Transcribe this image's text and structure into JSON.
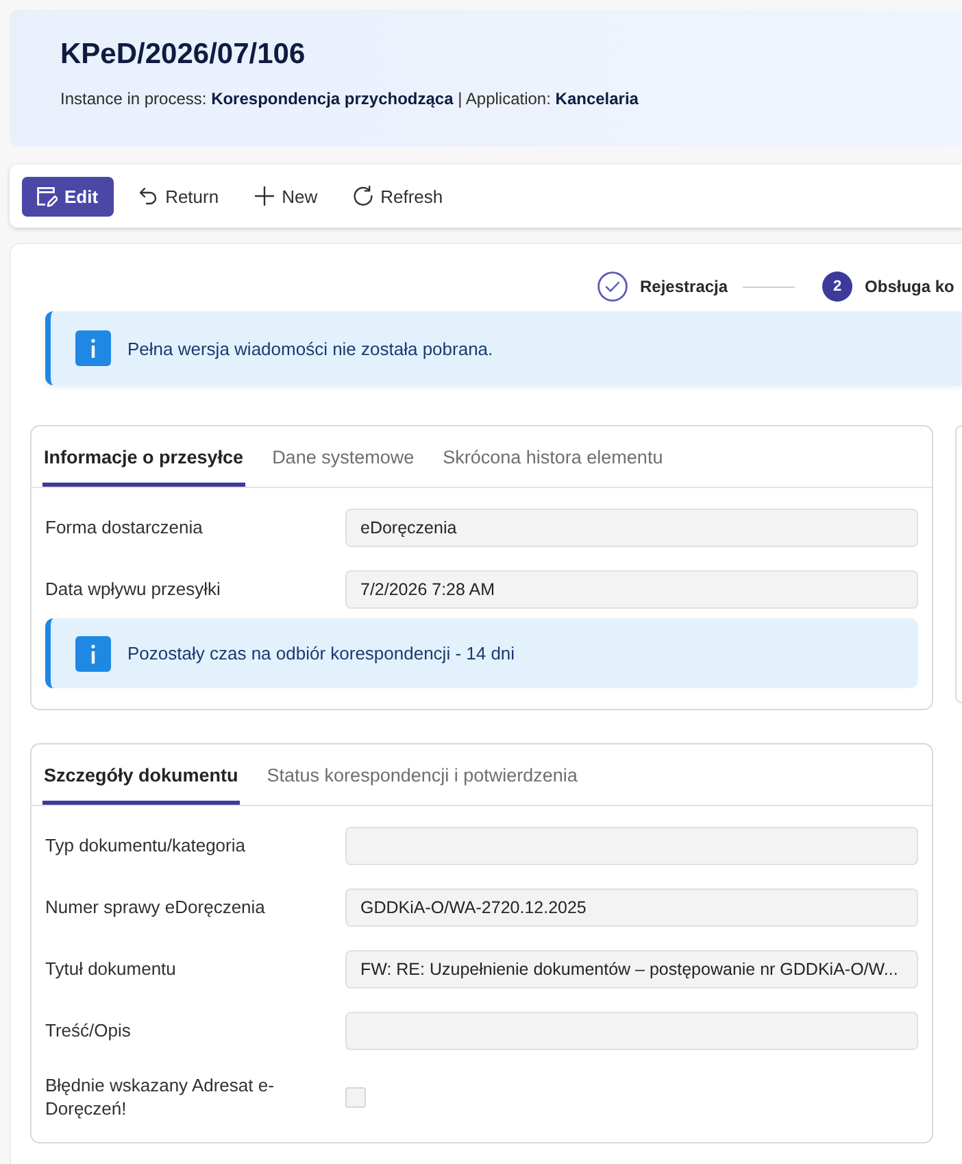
{
  "header": {
    "title": "KPeD/2026/07/106",
    "subtitle": "Instance in process: **Korespondencja przychodząca** | Application: **Kancelaria**"
  },
  "toolbar": {
    "buttons": [
      {
        "label": "Edit",
        "kind": "edit",
        "primary": true
      },
      {
        "label": "Return",
        "kind": "return",
        "primary": false
      },
      {
        "label": "New",
        "kind": "new",
        "primary": false
      },
      {
        "label": "Refresh",
        "kind": "refresh",
        "primary": false
      }
    ]
  },
  "stepper": {
    "steps": [
      {
        "label": "Rejestracja",
        "completed": true
      },
      {
        "label": "Obsługa ko",
        "number": "2",
        "completed": false
      }
    ]
  },
  "notice": {
    "text": "Pełna wersja wiadomości nie została pobrana."
  },
  "panels": [
    {
      "tabs": [
        {
          "label": "Informacje o przesyłce",
          "selected": true
        },
        {
          "label": "Dane systemowe",
          "selected": false
        },
        {
          "label": "Skrócona histora elementu",
          "selected": false
        }
      ],
      "fields": [
        {
          "kind": "text",
          "label": "Forma dostarczenia",
          "value": "eDoręczenia"
        },
        {
          "kind": "text",
          "label": "Data wpływu przesyłki",
          "value": "7/2/2026 7:28 AM"
        }
      ],
      "notice": {
        "text": "Pozostały czas na odbiór korespondencji - 14 dni"
      }
    },
    {
      "tabs": [
        {
          "label": "Szczegóły dokumentu",
          "selected": true
        },
        {
          "label": "Status korespondencji i potwierdzenia",
          "selected": false
        }
      ],
      "fields": [
        {
          "kind": "text",
          "label": "Typ dokumentu/kategoria"
        },
        {
          "kind": "text",
          "label": "Numer sprawy eDoręczenia",
          "value": "GDDKiA-O/WA-2720.12.2025"
        },
        {
          "kind": "text",
          "label": "Tytuł dokumentu",
          "value": "FW: RE: Uzupełnienie dokumentów – postępowanie nr GDDKiA-O/W..."
        },
        {
          "kind": "text",
          "label": "Treść/Opis"
        },
        {
          "kind": "checkbox",
          "label": "Błędnie wskazany Adresat e-Doręczeń!",
          "checked": false,
          "disabled": true
        }
      ]
    }
  ]
}
